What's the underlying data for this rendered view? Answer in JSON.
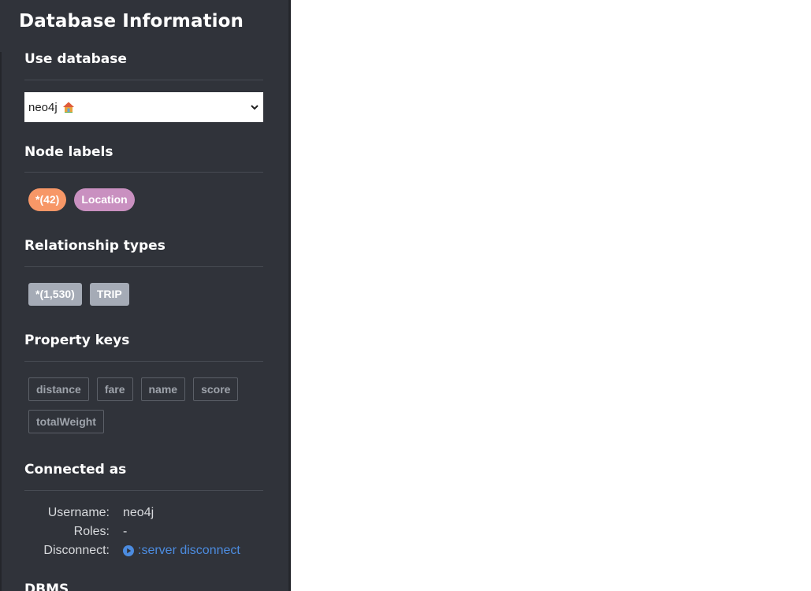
{
  "panel": {
    "title": "Database Information"
  },
  "use_database": {
    "heading": "Use database",
    "selected": "neo4j",
    "selected_icon": "house-icon"
  },
  "node_labels": {
    "heading": "Node labels",
    "items": [
      {
        "label": "*(42)",
        "color": "#f79767"
      },
      {
        "label": "Location",
        "color": "#c990c0"
      }
    ]
  },
  "relationship_types": {
    "heading": "Relationship types",
    "items": [
      {
        "label": "*(1,530)"
      },
      {
        "label": "TRIP"
      }
    ]
  },
  "property_keys": {
    "heading": "Property keys",
    "items": [
      "distance",
      "fare",
      "name",
      "score",
      "totalWeight"
    ]
  },
  "connected_as": {
    "heading": "Connected as",
    "username_key": "Username:",
    "username_value": "neo4j",
    "roles_key": "Roles:",
    "roles_value": "-",
    "disconnect_key": "Disconnect:",
    "disconnect_link": ":server disconnect",
    "link_color": "#4c8ce0",
    "link_icon": "play-circle-icon"
  },
  "dbms": {
    "heading": "DBMS"
  },
  "colors": {
    "sidebar_bg": "#30333a",
    "rel_chip": "#a5abb6"
  }
}
